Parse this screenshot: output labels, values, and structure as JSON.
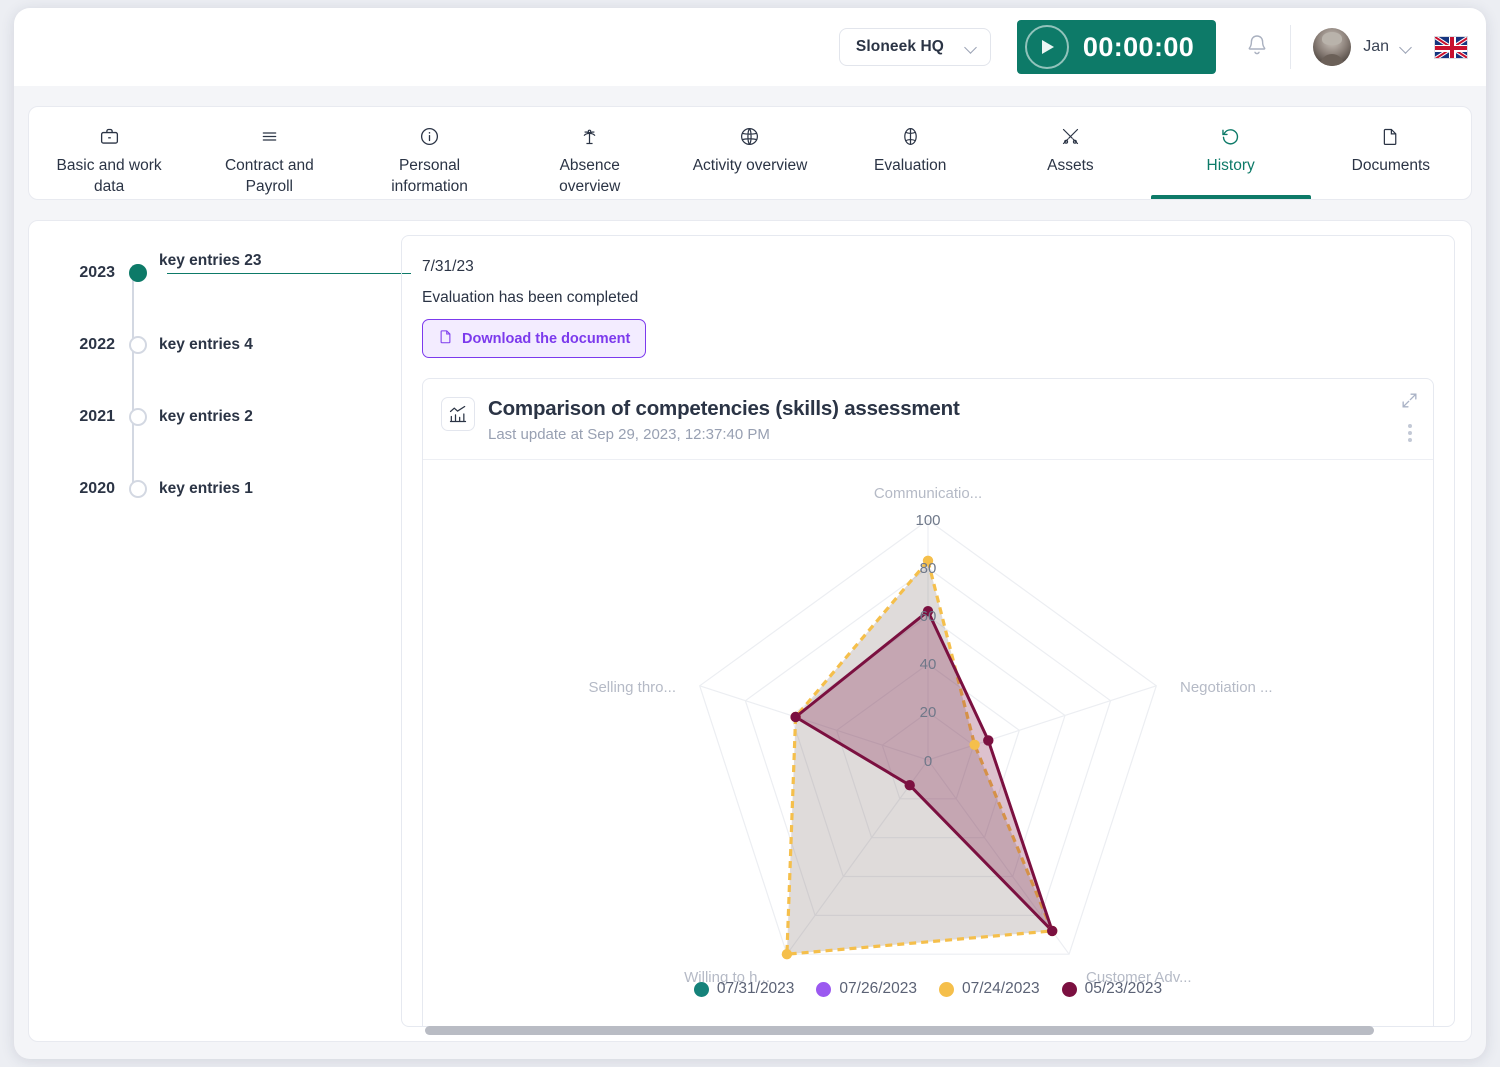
{
  "topbar": {
    "org_select": {
      "label": "Sloneek HQ",
      "icon": "chevron-down-icon"
    },
    "timer": {
      "value": "00:00:00",
      "play_icon": "play-icon",
      "accent": "#0d7a68"
    },
    "bell_icon": "bell-icon",
    "user": {
      "name": "Jan",
      "avatar": "user-avatar",
      "chevron": "chevron-down-icon"
    },
    "language_flag": "uk-flag-icon"
  },
  "tabs": [
    {
      "label": "Basic and work data",
      "icon": "briefcase-icon",
      "active": false
    },
    {
      "label": "Contract and Payroll",
      "icon": "list-icon",
      "active": false
    },
    {
      "label": "Personal information",
      "icon": "info-circle-icon",
      "active": false
    },
    {
      "label": "Absence overview",
      "icon": "palm-tree-icon",
      "active": false
    },
    {
      "label": "Activity overview",
      "icon": "activity-icon",
      "active": false
    },
    {
      "label": "Evaluation",
      "icon": "evaluation-icon",
      "active": false
    },
    {
      "label": "Assets",
      "icon": "tools-icon",
      "active": false
    },
    {
      "label": "History",
      "icon": "history-icon",
      "active": true
    },
    {
      "label": "Documents",
      "icon": "document-icon",
      "active": false
    }
  ],
  "timeline": [
    {
      "year": "2023",
      "label": "key entries 23",
      "active": true
    },
    {
      "year": "2022",
      "label": "key entries 4",
      "active": false
    },
    {
      "year": "2021",
      "label": "key entries 2",
      "active": false
    },
    {
      "year": "2020",
      "label": "key entries 1",
      "active": false
    }
  ],
  "event": {
    "date": "7/31/23",
    "text": "Evaluation has been completed",
    "download_button": {
      "label": "Download the document",
      "icon": "file-icon"
    }
  },
  "chart_card": {
    "title": "Comparison of competencies (skills) assessment",
    "subtitle": "Last update at Sep 29, 2023, 12:37:40 PM",
    "icon": "bar-chart-icon",
    "expand_icon": "expand-icon",
    "menu_icon": "kebab-menu-icon"
  },
  "chart_data": {
    "type": "radar",
    "title": "Comparison of competencies (skills) assessment",
    "categories": [
      "Communicatio...",
      "Negotiation ...",
      "Customer Adv...",
      "Willing to h...",
      "Selling thro..."
    ],
    "ticks": [
      0,
      20,
      40,
      60,
      80,
      100
    ],
    "rlim": [
      0,
      100
    ],
    "grid": true,
    "legend_position": "bottom",
    "series": [
      {
        "name": "07/31/2023",
        "color": "#15827a",
        "values": [
          null,
          null,
          null,
          null,
          null
        ]
      },
      {
        "name": "07/26/2023",
        "color": "#9b59f0",
        "values": [
          null,
          null,
          null,
          null,
          null
        ]
      },
      {
        "name": "07/24/2023",
        "color": "#f5bf4b",
        "values": [
          83,
          17,
          88,
          100,
          58
        ]
      },
      {
        "name": "05/23/2023",
        "color": "#7b1040",
        "values": [
          62,
          22,
          88,
          13,
          58
        ]
      }
    ]
  },
  "scrollbar": {
    "name": "horizontal-scrollbar"
  }
}
